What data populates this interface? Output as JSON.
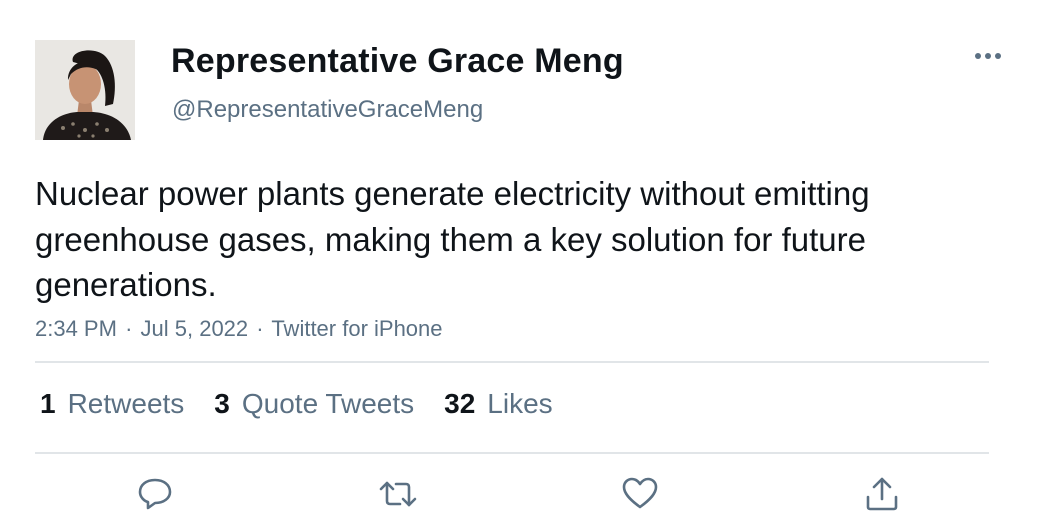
{
  "author": {
    "display_name": "Representative Grace Meng",
    "handle": "@RepresentativeGraceMeng"
  },
  "tweet": {
    "text": "Nuclear power plants generate electricity without emitting greenhouse gases, making them a key solution for future generations.",
    "time": "2:34 PM",
    "date": "Jul 5, 2022",
    "source": "Twitter for iPhone",
    "separator": "·"
  },
  "stats": [
    {
      "count": "1",
      "label": "Retweets"
    },
    {
      "count": "3",
      "label": "Quote Tweets"
    },
    {
      "count": "32",
      "label": "Likes"
    }
  ],
  "icons": {
    "more": "more-icon",
    "reply": "reply-icon",
    "retweet": "retweet-icon",
    "like": "heart-icon",
    "share": "share-icon"
  },
  "colors": {
    "text": "#0f1419",
    "secondary": "#5b7083",
    "divider": "#e1e5e8",
    "icon": "#5b7083"
  }
}
